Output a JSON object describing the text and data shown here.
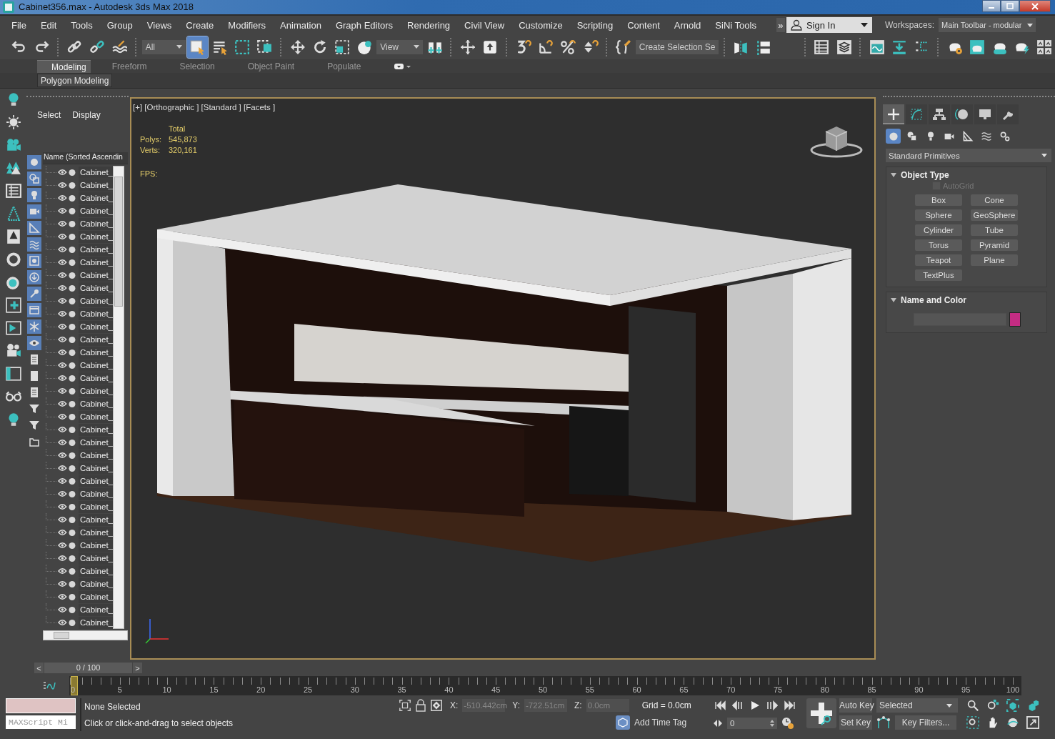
{
  "window": {
    "title": "Cabinet356.max - Autodesk 3ds Max 2018"
  },
  "menu": [
    "File",
    "Edit",
    "Tools",
    "Group",
    "Views",
    "Create",
    "Modifiers",
    "Animation",
    "Graph Editors",
    "Rendering",
    "Civil View",
    "Customize",
    "Scripting",
    "Content",
    "Arnold",
    "SiNi Tools"
  ],
  "menu_overflow": "»",
  "sign_in": {
    "label": "Sign In"
  },
  "workspaces": {
    "label": "Workspaces:",
    "value": "Main Toolbar - modular"
  },
  "main_toolbar": {
    "selection_filter": "All",
    "select_object_active": true,
    "reference_coord": "View",
    "selection_set": "Create Selection Se"
  },
  "ribbon": {
    "tabs": [
      {
        "label": "Modeling",
        "selected": true
      },
      {
        "label": "Freeform",
        "selected": false
      },
      {
        "label": "Selection",
        "selected": false
      },
      {
        "label": "Object Paint",
        "selected": false
      },
      {
        "label": "Populate",
        "selected": false
      }
    ],
    "panel": "Polygon Modeling"
  },
  "scene_explorer": {
    "tabs": [
      "Select",
      "Display"
    ],
    "column": "Name (Sorted Ascendin",
    "filters": [
      {
        "on": true
      },
      {
        "on": true
      },
      {
        "on": true
      },
      {
        "on": true
      },
      {
        "on": true
      },
      {
        "on": true
      },
      {
        "on": true
      },
      {
        "on": true
      },
      {
        "on": true
      },
      {
        "on": true
      },
      {
        "on": true
      },
      {
        "on": true
      },
      {
        "on": false
      },
      {
        "on": false
      },
      {
        "on": false
      },
      {
        "on": false
      },
      {
        "on": false
      },
      {
        "on": false
      }
    ],
    "rows": [
      {
        "name": "Cabinet_"
      },
      {
        "name": "Cabinet_"
      },
      {
        "name": "Cabinet_"
      },
      {
        "name": "Cabinet_"
      },
      {
        "name": "Cabinet_"
      },
      {
        "name": "Cabinet_"
      },
      {
        "name": "Cabinet_"
      },
      {
        "name": "Cabinet_"
      },
      {
        "name": "Cabinet_"
      },
      {
        "name": "Cabinet_"
      },
      {
        "name": "Cabinet_"
      },
      {
        "name": "Cabinet_"
      },
      {
        "name": "Cabinet_"
      },
      {
        "name": "Cabinet_"
      },
      {
        "name": "Cabinet_"
      },
      {
        "name": "Cabinet_"
      },
      {
        "name": "Cabinet_"
      },
      {
        "name": "Cabinet_"
      },
      {
        "name": "Cabinet_"
      },
      {
        "name": "Cabinet_"
      },
      {
        "name": "Cabinet_"
      },
      {
        "name": "Cabinet_"
      },
      {
        "name": "Cabinet_"
      },
      {
        "name": "Cabinet_"
      },
      {
        "name": "Cabinet_"
      },
      {
        "name": "Cabinet_"
      },
      {
        "name": "Cabinet_"
      },
      {
        "name": "Cabinet_"
      },
      {
        "name": "Cabinet_"
      },
      {
        "name": "Cabinet_"
      },
      {
        "name": "Cabinet_"
      },
      {
        "name": "Cabinet_"
      },
      {
        "name": "Cabinet_"
      },
      {
        "name": "Cabinet_"
      },
      {
        "name": "Cabinet_"
      },
      {
        "name": "Cabinet_"
      }
    ]
  },
  "viewport": {
    "label": "[+] [Orthographic ] [Standard ] [Facets ]",
    "stats_heading": "Total",
    "stats": [
      {
        "label": "Polys:",
        "value": "545,873"
      },
      {
        "label": "Verts:",
        "value": "320,161"
      }
    ],
    "fps_label": "FPS:"
  },
  "command_panel": {
    "tabs": [
      {
        "selected": true
      },
      {
        "selected": false
      },
      {
        "selected": false
      },
      {
        "selected": false
      },
      {
        "selected": false
      },
      {
        "selected": false
      }
    ],
    "categories": [
      {
        "selected": true
      },
      {
        "selected": false
      },
      {
        "selected": false
      },
      {
        "selected": false
      },
      {
        "selected": false
      },
      {
        "selected": false
      },
      {
        "selected": false
      }
    ],
    "category_list": "Standard Primitives",
    "object_type": {
      "title": "Object Type",
      "autogrid": {
        "label": "AutoGrid",
        "checked": false,
        "disabled": true
      },
      "buttons": [
        "Box",
        "Cone",
        "Sphere",
        "GeoSphere",
        "Cylinder",
        "Tube",
        "Torus",
        "Pyramid",
        "Teapot",
        "Plane",
        "TextPlus"
      ]
    },
    "name_and_color": {
      "title": "Name and Color",
      "color": "#c42c83"
    }
  },
  "timeline": {
    "frame": "0 / 100",
    "level": 0,
    "prev": "<",
    "next": ">",
    "ticks": [
      "0",
      "5",
      "10",
      "15",
      "20",
      "25",
      "30",
      "35",
      "40",
      "45",
      "50",
      "55",
      "60",
      "65",
      "70",
      "75",
      "80",
      "85",
      "90",
      "95",
      "100"
    ]
  },
  "status": {
    "script_field": "MAXScript Mi",
    "selection": "None Selected",
    "prompt": "Click or click-and-drag to select objects",
    "coords": [
      {
        "axis": "X:",
        "value": "-510.442cm",
        "disabled": true
      },
      {
        "axis": "Y:",
        "value": "-722.51cm",
        "disabled": true
      },
      {
        "axis": "Z:",
        "value": "0.0cm",
        "disabled": true
      }
    ],
    "grid": "Grid = 0.0cm",
    "time_tag": "Add Time Tag",
    "current_frame": "0",
    "auto_key": "Auto Key",
    "key_mode": "Selected",
    "set_key": "Set Key",
    "key_filters": "Key Filters..."
  }
}
